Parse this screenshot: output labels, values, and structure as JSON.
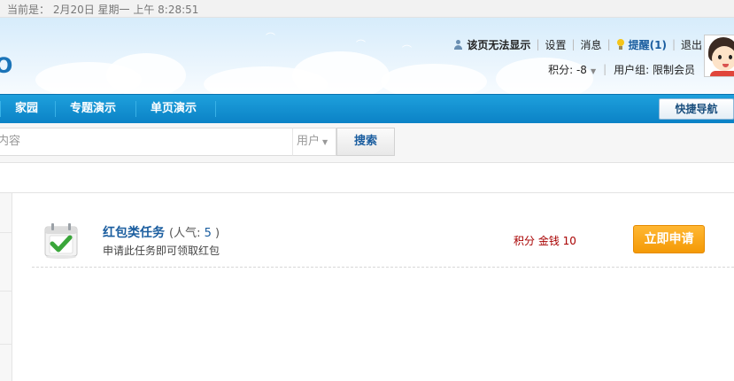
{
  "topbar": {
    "date": "当前是：  2月20日  星期一  上午  8:28:51"
  },
  "header": {
    "logo_fragment": "O",
    "page_notice": "该页无法显示",
    "settings": "设置",
    "messages": "消息",
    "remind": "提醒(1)",
    "logout": "退出",
    "points_label": "积分: -8",
    "user_group": "用户组: 限制会员"
  },
  "nav": {
    "items": [
      "家园",
      "专题演示",
      "单页演示"
    ],
    "quick_nav": "快捷导航"
  },
  "search": {
    "placeholder": "内容",
    "type": "用户",
    "button": "搜索"
  },
  "task": {
    "title": "红包类任务",
    "popularity_label": "(人气:",
    "popularity_value": "5",
    "popularity_close": ")",
    "description": "申请此任务即可领取红包",
    "reward": "积分 金钱 10",
    "apply_button": "立即申请"
  },
  "icons": {
    "user": "person-icon",
    "remind": "bulb-icon",
    "task": "check-calendar-icon",
    "avatar": "cartoon-avatar"
  },
  "colors": {
    "nav_bg": "#0b82c6",
    "link_blue": "#1a5d9f",
    "apply_orange": "#f49a06",
    "reward_red": "#a80000"
  }
}
